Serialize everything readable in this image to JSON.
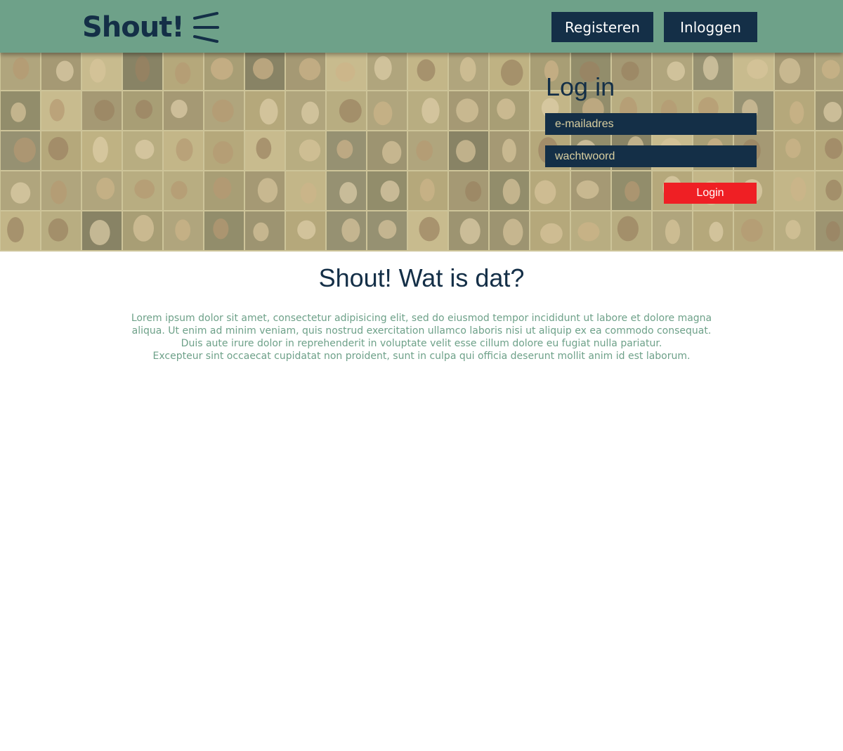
{
  "header": {
    "logo_text": "Shout!",
    "register_label": "Registeren",
    "login_label": "Inloggen"
  },
  "login": {
    "title": "Log in",
    "email_placeholder": "e-mailadres",
    "password_placeholder": "wachtwoord",
    "submit_label": "Login"
  },
  "about": {
    "title": "Shout! Wat is dat?",
    "lines": [
      "Lorem ipsum dolor sit amet, consectetur adipisicing elit, sed do eiusmod tempor incididunt ut labore et dolore magna",
      "aliqua. Ut enim ad minim veniam, quis nostrud exercitation ullamco laboris nisi ut aliquip ex ea commodo consequat.",
      "Duis aute irure dolor in reprehenderit in voluptate velit esse cillum dolore eu fugiat nulla pariatur.",
      "Excepteur sint occaecat cupidatat non proident, sunt in culpa qui officia deserunt mollit anim id est laborum."
    ]
  },
  "colors": {
    "header_bg": "#6ea189",
    "navy": "#142f47",
    "accent_red": "#ef1f24",
    "body_text": "#6ea189"
  }
}
